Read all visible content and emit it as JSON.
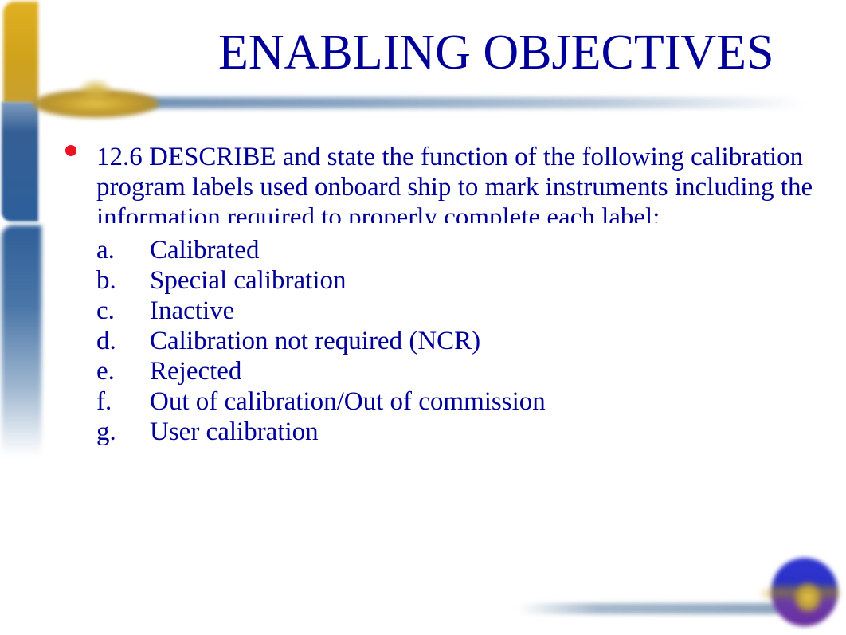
{
  "slide": {
    "title": "ENABLING OBJECTIVES",
    "objective": {
      "bullet_icon": "bullet-dot",
      "text": "12.6 DESCRIBE and state the function of the following calibration program labels used onboard ship to mark instruments including the information required to properly complete each label:"
    },
    "labels": [
      {
        "marker": "a.",
        "text": "Calibrated"
      },
      {
        "marker": "b.",
        "text": "Special calibration"
      },
      {
        "marker": "c.",
        "text": "Inactive"
      },
      {
        "marker": "d.",
        "text": "Calibration not required (NCR)"
      },
      {
        "marker": "e.",
        "text": "Rejected"
      },
      {
        "marker": "f.",
        "text": "Out of calibration/Out of commission"
      },
      {
        "marker": "g.",
        "text": "User calibration"
      }
    ]
  },
  "colors": {
    "title_text": "#000099",
    "body_text": "#000099",
    "bullet": "#ee1122",
    "accent_gold": "#cfa21d",
    "accent_blue": "#2e5f9b"
  }
}
